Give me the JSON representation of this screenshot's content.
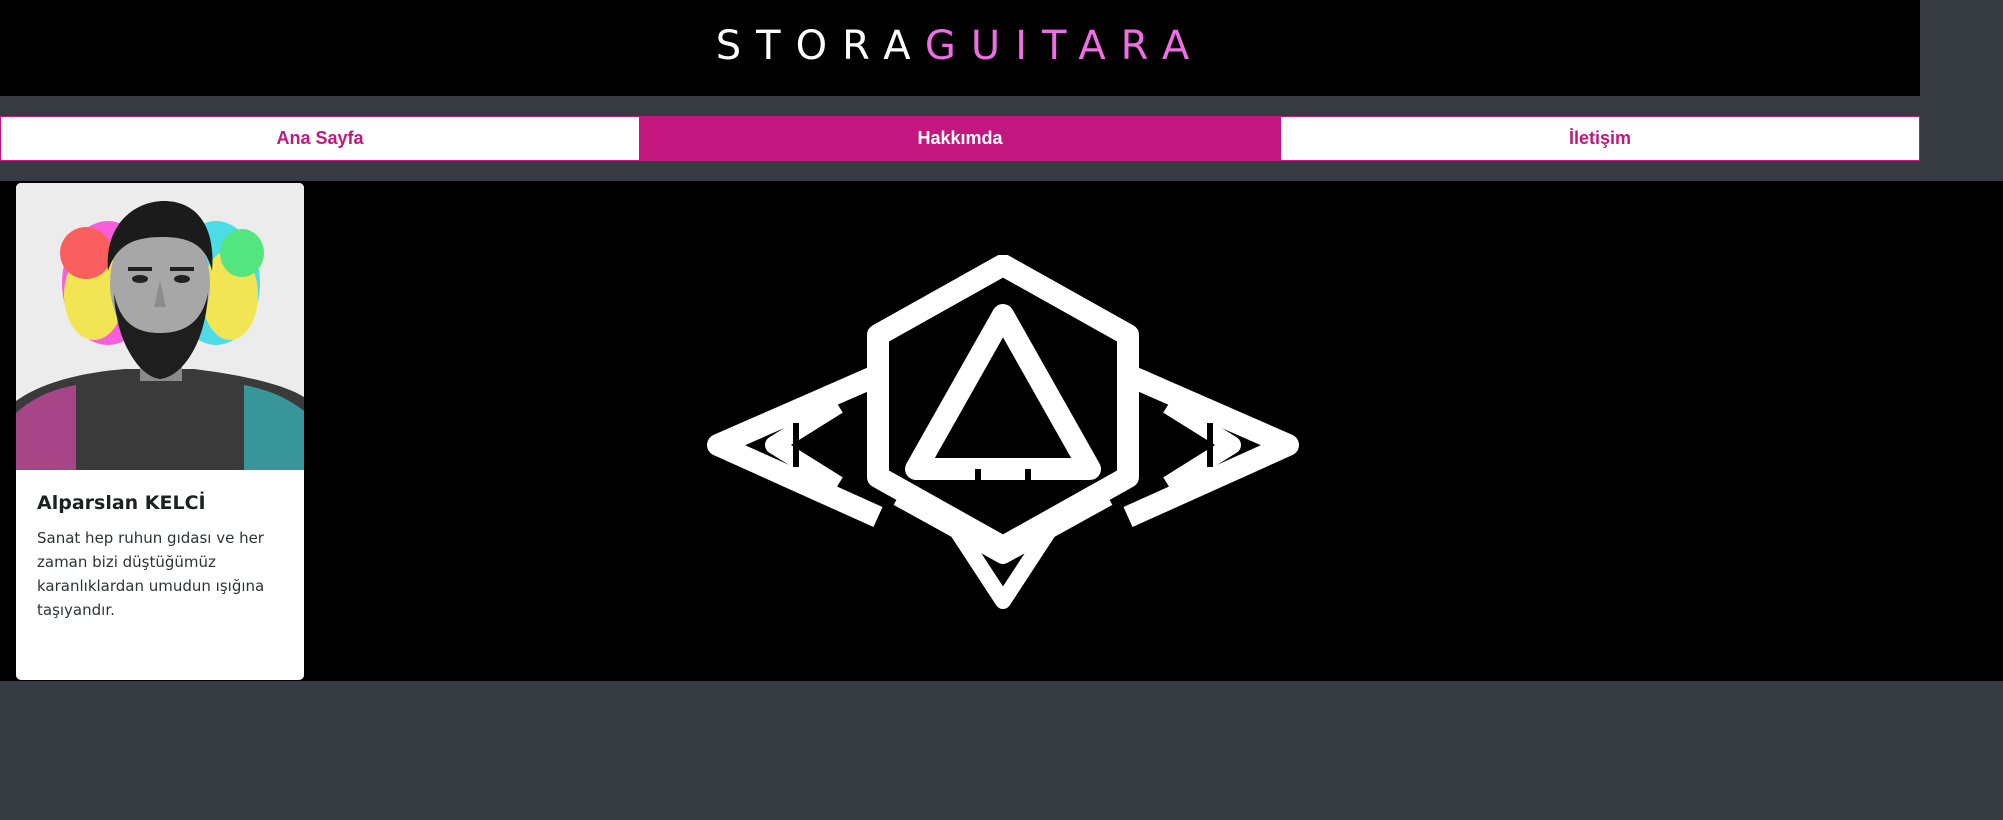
{
  "header": {
    "brand_white": "STORA",
    "brand_pink": "GUITARA",
    "colors": {
      "background": "#000000",
      "white": "#ffffff",
      "pink": "#ee6ee4"
    }
  },
  "nav": {
    "items": [
      {
        "label": "Ana Sayfa",
        "active": false
      },
      {
        "label": "Hakkımda",
        "active": true
      },
      {
        "label": "İletişim",
        "active": false
      }
    ],
    "accent": "#c3177f"
  },
  "profile": {
    "name": "Alparslan KELCİ",
    "bio": "Sanat hep ruhun gıdası ve her zaman bizi düştüğümüz karanlıklardan umudun ışığına taşıyandır.",
    "photo_icon": "portrait-photo"
  },
  "banner": {
    "logo_icon": "geometric-diamond-logo",
    "background": "#000000"
  },
  "page": {
    "background": "#363a41"
  }
}
